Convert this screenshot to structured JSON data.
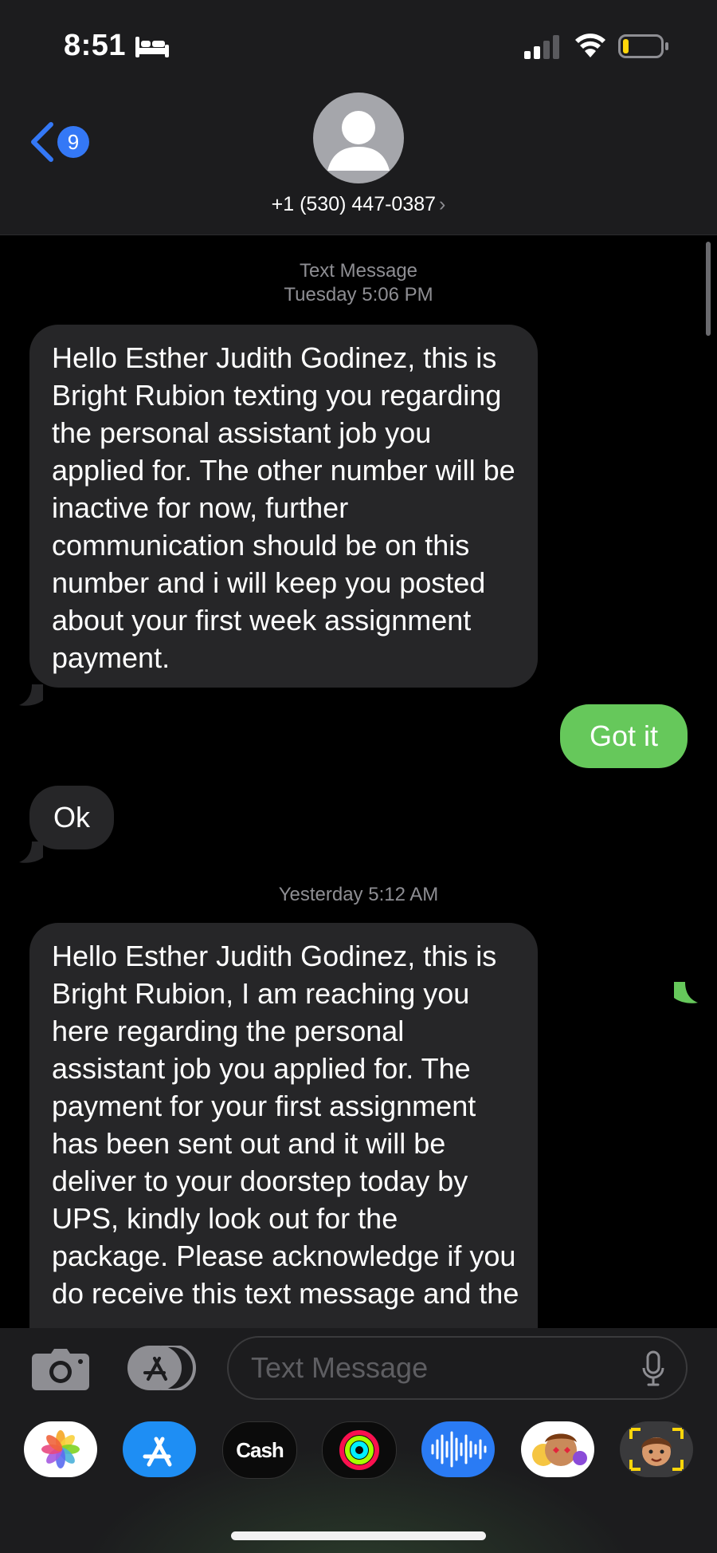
{
  "status_bar": {
    "time": "8:51",
    "icons": [
      "bed-icon",
      "cellular-signal-icon",
      "wifi-icon",
      "battery-icon"
    ]
  },
  "header": {
    "back_badge": "9",
    "contact": "+1 (530) 447-0387",
    "contact_chevron": "›"
  },
  "conversation": {
    "service_label": "Text Message",
    "timestamp_1": "Tuesday 5:06 PM",
    "message_1": "Hello Esther Judith Godinez, this is Bright Rubion texting you regarding the personal assistant job you applied for. The other number will be inactive for now, further communication should be on this number and i will keep you posted about your first week assignment payment.",
    "reply_1": "Got it",
    "message_2": "Ok",
    "timestamp_2": "Yesterday 5:12 AM",
    "message_3": "Hello Esther Judith Godinez, this is Bright Rubion,  I am reaching you here regarding the personal assistant job you applied for. The payment for your first assignment has been sent out and it will be deliver to your doorstep today by UPS, kindly look out for the package. Please acknowledge if you do receive this text message and the"
  },
  "compose": {
    "placeholder": "Text Message"
  },
  "app_drawer": {
    "apps": [
      "Photos",
      "App Store",
      "Cash",
      "Activity",
      "Audio Message",
      "Memoji Stickers",
      "Memoji"
    ],
    "cash_label": "Cash"
  },
  "colors": {
    "incoming_bubble": "#262628",
    "outgoing_bubble": "#66c85b",
    "accent_blue": "#3478f6",
    "chrome": "#1c1c1e"
  }
}
